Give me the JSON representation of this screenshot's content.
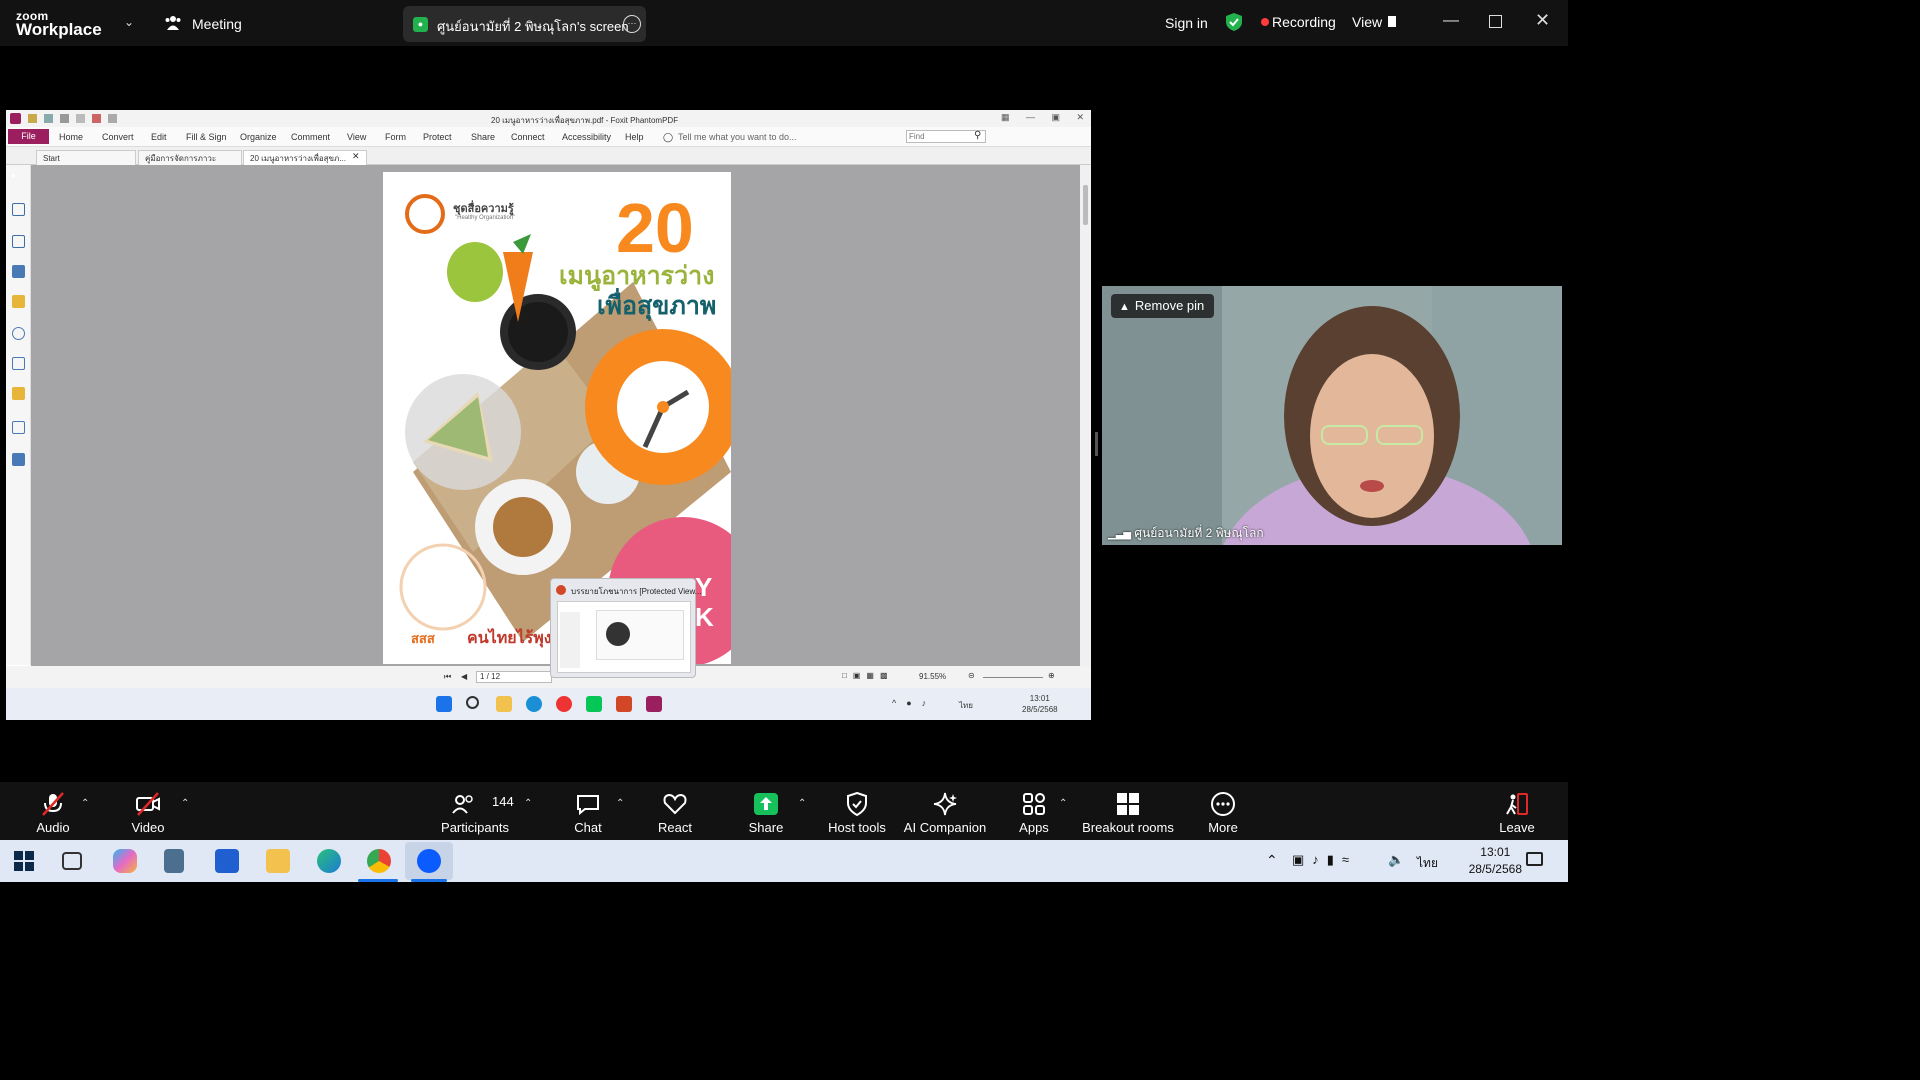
{
  "topbar": {
    "brand_small": "zoom",
    "brand_big": "Workplace",
    "meeting_label": "Meeting",
    "share_label": "ศูนย์อนามัยที่ 2 พิษณุโลก's screen",
    "sign_in": "Sign in",
    "recording": "Recording",
    "view": "View"
  },
  "foxit": {
    "title": "20 เมนูอาหารว่างเพื่อสุขภาพ.pdf - Foxit PhantomPDF",
    "file_tab": "File",
    "ribbon": [
      "Home",
      "Convert",
      "Edit",
      "Fill & Sign",
      "Organize",
      "Comment",
      "View",
      "Form",
      "Protect",
      "Share",
      "Connect",
      "Accessibility",
      "Help"
    ],
    "tell_me": "Tell me what you want to do...",
    "find_placeholder": "Find",
    "tabs": [
      "Start",
      "คู่มือการจัดการภาวะโภชน...",
      "20 เมนูอาหารว่างเพื่อสุขภ..."
    ],
    "page_indicator": "1 / 12",
    "zoom_level": "91.55%",
    "clock_time": "13:01",
    "clock_date": "28/5/2568",
    "lang": "ไทย"
  },
  "poster": {
    "number": "20",
    "title_line1": "เมนูอาหารว่าง",
    "title_line2": "เพื่อสุขภาพ",
    "brand": "ชุดสื่อความรู้",
    "brand_sub": "\"Healthy Organization\"",
    "partner1": "สสส",
    "partner2": "คนไทยไร้พุง",
    "partial": "Y\nK"
  },
  "preview": {
    "title": "บรรยายโภชนาการ [Protected View..."
  },
  "video": {
    "remove_pin": "Remove pin",
    "participant_name": "ศูนย์อนามัยที่ 2 พิษณุโลก"
  },
  "controls": {
    "audio": "Audio",
    "video": "Video",
    "participants_count": "144",
    "participants": "Participants",
    "chat": "Chat",
    "react": "React",
    "share": "Share",
    "host_tools": "Host tools",
    "ai_companion": "AI Companion",
    "apps": "Apps",
    "breakout": "Breakout rooms",
    "more": "More",
    "leave": "Leave"
  },
  "taskbar": {
    "time": "13:01",
    "date": "28/5/2568",
    "lang": "ไทย"
  },
  "colors": {
    "zoom_green": "#22b14c",
    "recording_red": "#ff3b3b",
    "share_green": "#16c15b",
    "foxit_magenta": "#9b1f5f",
    "poster_orange": "#f7891f",
    "poster_green": "#9ab33b",
    "poster_teal": "#14606b"
  }
}
